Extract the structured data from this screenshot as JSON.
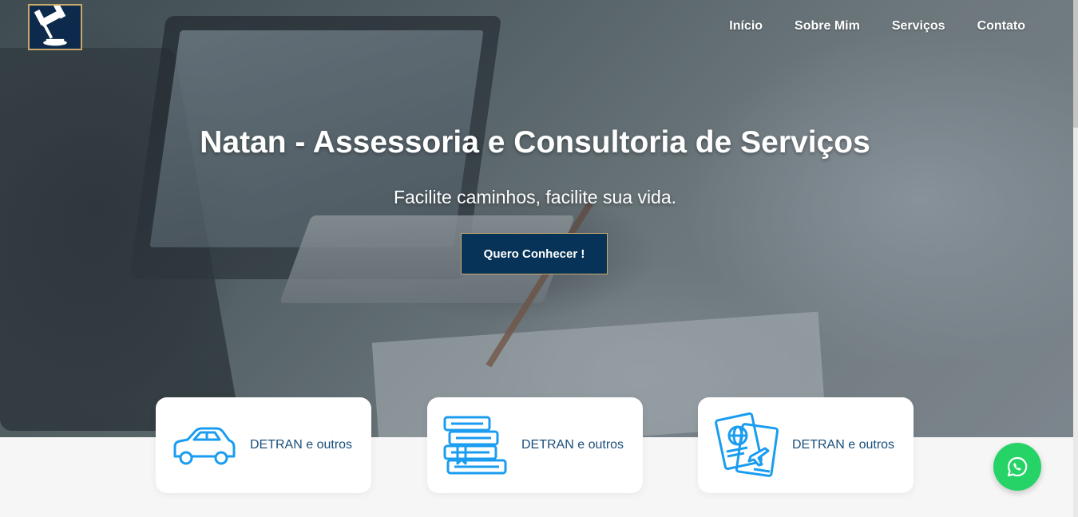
{
  "nav": {
    "items": [
      {
        "label": "Início"
      },
      {
        "label": "Sobre Mim"
      },
      {
        "label": "Serviços"
      },
      {
        "label": "Contato"
      }
    ]
  },
  "hero": {
    "title": "Natan - Assessoria e Consultoria de Serviços",
    "subtitle": "Facilite caminhos, facilite sua vida.",
    "cta_label": "Quero Conhecer !"
  },
  "cards": [
    {
      "icon": "car-icon",
      "label": "DETRAN e outros"
    },
    {
      "icon": "books-icon",
      "label": "DETRAN e outros"
    },
    {
      "icon": "passport-icon",
      "label": "DETRAN e outros"
    }
  ],
  "colors": {
    "brand_navy": "#073358",
    "logo_gold": "#c9a96a",
    "icon_blue": "#1a9cf0",
    "card_text": "#1a4e7a",
    "whatsapp_green": "#25d366"
  },
  "floating": {
    "icon": "whatsapp-icon"
  },
  "logo": {
    "icon": "gavel-icon"
  }
}
